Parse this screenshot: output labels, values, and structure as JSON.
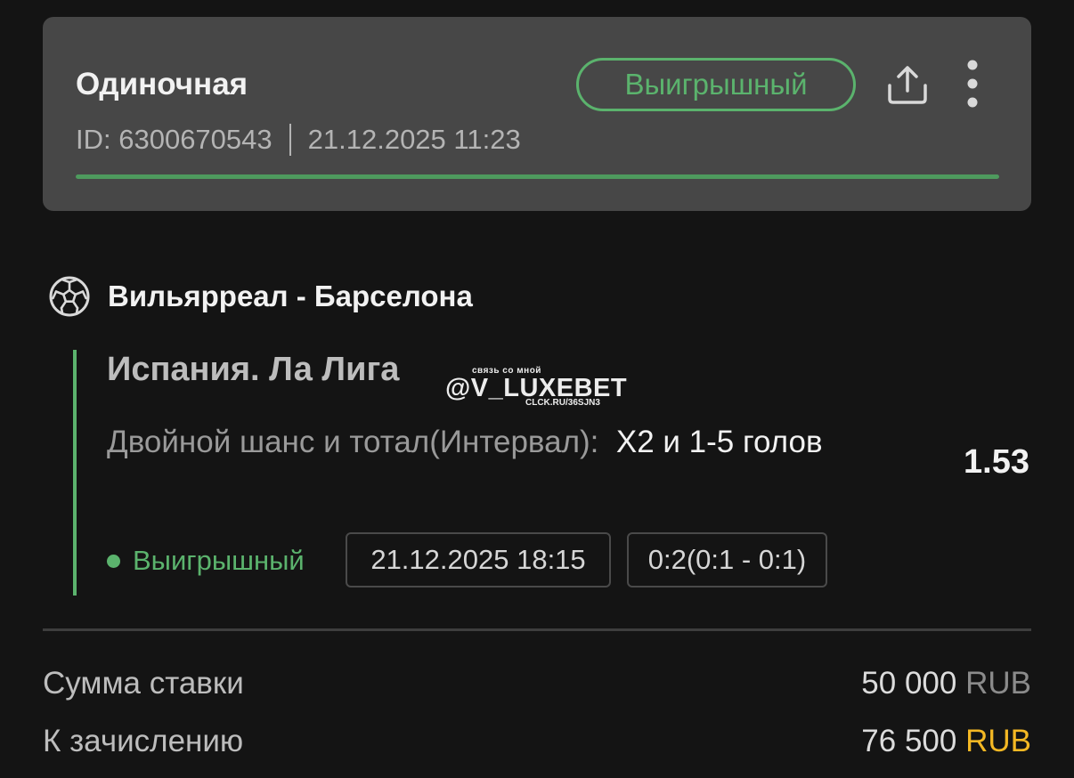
{
  "header": {
    "bet_type": "Одиночная",
    "status_label": "Выигрышный",
    "id_label": "ID: 6300670543",
    "datetime": "21.12.2025 11:23",
    "progress": 1.0,
    "status_color": "#5bb36d",
    "share_icon": "share-icon",
    "more_icon": "more-vertical-icon"
  },
  "event": {
    "sport_icon": "soccer-ball-icon",
    "name": "Вильярреал - Барселона",
    "league": "Испания. Ла Лига",
    "market_label": "Двойной шанс и тотал(Интервал):",
    "market_value": "X2 и 1-5 голов",
    "odds": "1.53",
    "status": "Выигрышный",
    "start_time": "21.12.2025 18:15",
    "score": "0:2(0:1 - 0:1)"
  },
  "watermark": {
    "top": "связь со мной",
    "main": "@V_LUXEBET",
    "bottom": "CLCK.RU/36SJN3"
  },
  "summary": {
    "stake_label": "Сумма ставки",
    "stake_amount": "50 000",
    "stake_currency": "RUB",
    "payout_label": "К зачислению",
    "payout_amount": "76 500",
    "payout_currency": "RUB",
    "payout_currency_color": "#f4b824"
  }
}
